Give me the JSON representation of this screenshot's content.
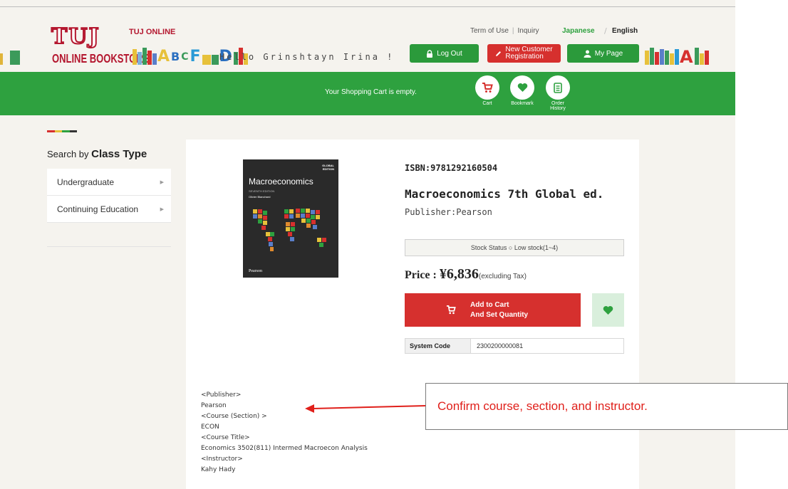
{
  "header": {
    "logo_main": "TUJ",
    "logo_sub": "ONLINE BOOKSTORE",
    "logo_online": "TUJ ONLINE",
    "greeting": "Hello Grinshtayn Irina !",
    "links": {
      "terms": "Term of Use",
      "inquiry": "Inquiry"
    },
    "lang": {
      "japanese": "Japanese",
      "english": "English"
    },
    "buttons": {
      "logout": "Log Out",
      "new_customer_1": "New Customer",
      "new_customer_2": "Registration",
      "mypage": "My Page"
    },
    "deco_letters": [
      "A",
      "B",
      "C",
      "F",
      "D",
      "A"
    ]
  },
  "greenbar": {
    "cart_message": "Your Shopping Cart is empty.",
    "icons": [
      {
        "label": "Cart",
        "icon": "cart-icon"
      },
      {
        "label": "Bookmark",
        "icon": "heart-icon"
      },
      {
        "label": "Order History",
        "icon": "order-history-icon"
      }
    ]
  },
  "sidebar": {
    "title_prefix": "Search by",
    "title_bold": "Class Type",
    "items": [
      {
        "label": "Undergraduate"
      },
      {
        "label": "Continuing Education"
      }
    ]
  },
  "product": {
    "cover": {
      "title": "Macroeconomics",
      "edition": "SEVENTH EDITION",
      "author": "Olivier Blanchard",
      "badge_1": "GLOBAL",
      "badge_2": "EDITION",
      "publisher_logo": "Pearson"
    },
    "isbn": "ISBN:9781292160504",
    "title": "Macroeconomics 7th Global ed.",
    "publisher": "Publisher:Pearson",
    "stock_status": "Stock Status ○ Low stock(1~4)",
    "price_label": "Price : ",
    "price_value": "¥6,836",
    "price_note": "(excluding Tax)",
    "add_to_cart_1": "Add to Cart",
    "add_to_cart_2": "And Set Quantity",
    "system_code_label": "System Code",
    "system_code_value": "2300200000081",
    "details": [
      "<Publisher>",
      "Pearson",
      "<Course (Section) >",
      "ECON",
      "<Course Title>",
      "Economics 3502(811) Intermed Macroecon Analysis",
      "<Instructor>",
      "Kahy Hady"
    ]
  },
  "callout": {
    "text": "Confirm course, section, and instructor."
  },
  "colors": {
    "green": "#2ea13f",
    "red": "#d6302e",
    "brand_red": "#b4172f",
    "callout_red": "#e0201b"
  }
}
